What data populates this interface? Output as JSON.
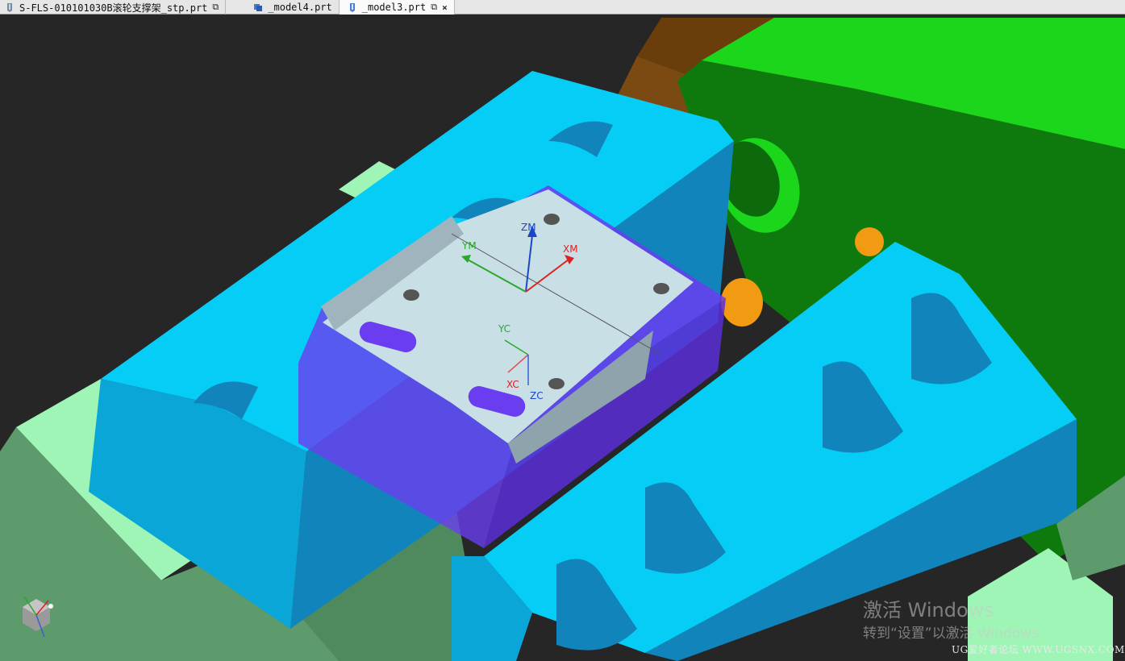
{
  "tabs": [
    {
      "label": "S-FLS-010101030B滚轮支撑架_stp.prt",
      "icon": "part-file-icon",
      "action": "restore-icon",
      "active": false
    },
    {
      "label": "_model4.prt",
      "icon": "assembly-icon",
      "action": "",
      "active": false
    },
    {
      "label": "_model3.prt",
      "icon": "part-file-icon",
      "action": "restore-icon",
      "close": "×",
      "active": true
    }
  ],
  "scene": {
    "colors": {
      "background": "#262626",
      "vise_blue": "#06cdf5",
      "vise_side": "#0aa6d8",
      "vise_dark": "#1185bb",
      "base_light_green": "#9ff5b6",
      "base_green": "#5d9a6c",
      "green_block": "#1bd61b",
      "dark_green": "#0e7a0e",
      "brown": "#6a3e0b",
      "orange": "#f29a12",
      "stock_purple": "#6a3df0",
      "plate": "#c9dfe6"
    },
    "work_csys": {
      "z": "ZM",
      "y": "YM",
      "x": "XM"
    },
    "absolute_csys": {
      "y": "YC",
      "x": "XC",
      "z": "ZC"
    }
  },
  "watermark": {
    "line1": "激活 Windows",
    "line2": "转到“设置”以激活 Windows",
    "forum": "UG爱好者论坛 WWW.UGSNX.COM"
  }
}
